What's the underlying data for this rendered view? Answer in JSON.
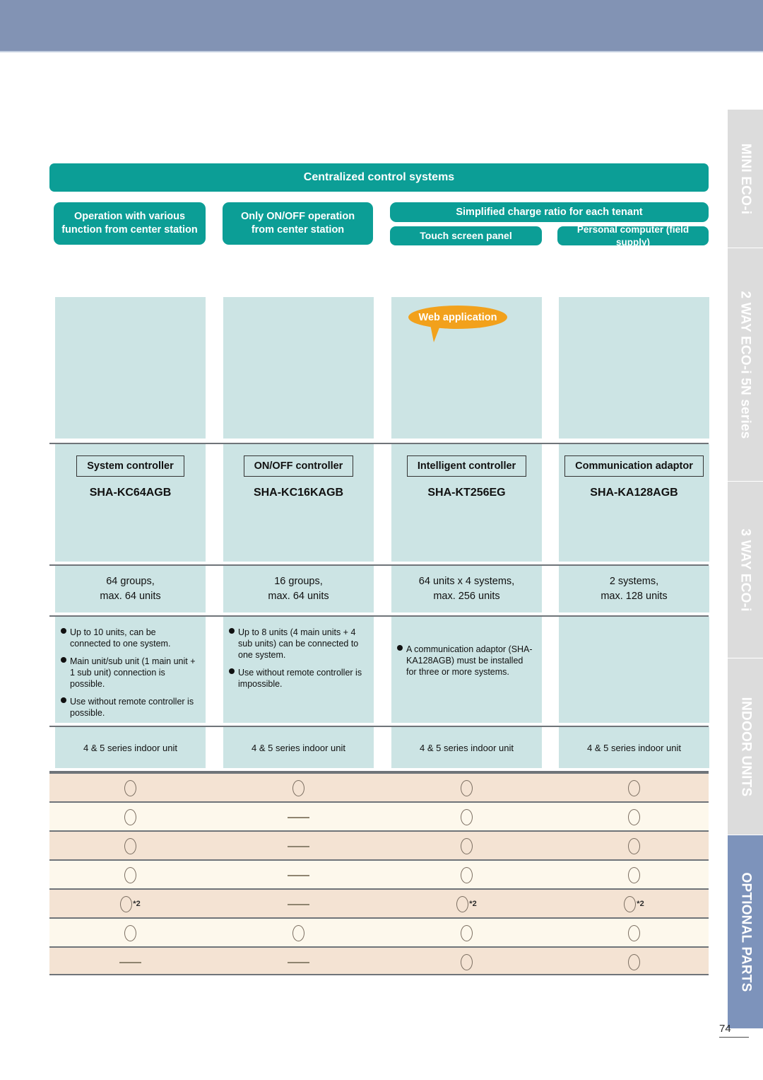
{
  "page": {
    "number": "74"
  },
  "sidebar": {
    "tabs": [
      {
        "label": "MINI ECO-i",
        "active": false
      },
      {
        "label": "2 WAY ECO-i 5N series",
        "active": false
      },
      {
        "label": "3 WAY ECO-i",
        "active": false
      },
      {
        "label": "INDOOR UNITS",
        "active": false
      },
      {
        "label": "OPTIONAL PARTS",
        "active": true
      }
    ],
    "active_color": "#7d93bb",
    "inactive_color": "#dcdcdc"
  },
  "header": {
    "title": "Centralized control systems",
    "categories": [
      "Operation with various function from center station",
      "Only ON/OFF operation from center station"
    ],
    "charge_ratio_title": "Simplified charge ratio for each tenant",
    "charge_ratio_options": [
      "Touch screen panel",
      "Personal computer (field supply)"
    ],
    "accent_color": "#0c9e96"
  },
  "callout": {
    "label": "Web application",
    "color": "#f2a11c"
  },
  "columns": [
    {
      "controller": "System controller",
      "model": "SHA-KC64AGB",
      "capacity_line1": "64 groups,",
      "capacity_line2": "max. 64 units",
      "notes": [
        "Up to 10 units, can be connected to one system.",
        "Main unit/sub unit (1 main unit + 1 sub unit) connection is possible.",
        "Use without remote controller is possible."
      ],
      "indoor_unit": "4 & 5 series indoor unit"
    },
    {
      "controller": "ON/OFF controller",
      "model": "SHA-KC16KAGB",
      "capacity_line1": "16 groups,",
      "capacity_line2": "max. 64 units",
      "notes": [
        "Up to 8 units (4 main units + 4 sub units) can be connected to one system.",
        "Use without remote controller is impossible."
      ],
      "indoor_unit": "4 & 5 series indoor unit"
    },
    {
      "controller": "Intelligent controller",
      "model": "SHA-KT256EG",
      "capacity_line1": "64 units x 4 systems,",
      "capacity_line2": "max. 256 units",
      "notes": [
        "A communication adaptor (SHA-KA128AGB) must be installed for three or more systems."
      ],
      "indoor_unit": "4 & 5 series indoor unit"
    },
    {
      "controller": "Communication adaptor",
      "model": "SHA-KA128AGB",
      "capacity_line1": "2 systems,",
      "capacity_line2": "max. 128 units",
      "notes": [],
      "indoor_unit": "4 & 5 series indoor unit"
    }
  ],
  "symbol_rows": [
    {
      "band": "odd",
      "cells": [
        {
          "sym": "circle"
        },
        {
          "sym": "circle"
        },
        {
          "sym": "circle"
        },
        {
          "sym": "circle"
        }
      ]
    },
    {
      "band": "even",
      "cells": [
        {
          "sym": "circle"
        },
        {
          "sym": "dash"
        },
        {
          "sym": "circle"
        },
        {
          "sym": "circle"
        }
      ]
    },
    {
      "band": "odd",
      "cells": [
        {
          "sym": "circle"
        },
        {
          "sym": "dash"
        },
        {
          "sym": "circle"
        },
        {
          "sym": "circle"
        }
      ]
    },
    {
      "band": "even",
      "cells": [
        {
          "sym": "circle"
        },
        {
          "sym": "dash"
        },
        {
          "sym": "circle"
        },
        {
          "sym": "circle"
        }
      ]
    },
    {
      "band": "odd",
      "cells": [
        {
          "sym": "circle",
          "note": "*2"
        },
        {
          "sym": "dash"
        },
        {
          "sym": "circle",
          "note": "*2"
        },
        {
          "sym": "circle",
          "note": "*2"
        }
      ]
    },
    {
      "band": "even",
      "cells": [
        {
          "sym": "circle"
        },
        {
          "sym": "circle"
        },
        {
          "sym": "circle"
        },
        {
          "sym": "circle"
        }
      ]
    },
    {
      "band": "odd",
      "cells": [
        {
          "sym": "dash"
        },
        {
          "sym": "dash"
        },
        {
          "sym": "circle"
        },
        {
          "sym": "circle"
        }
      ]
    }
  ],
  "palette": {
    "top_band": "#8293b4",
    "image_box": "#cce4e4",
    "band_odd": "#f4e3d3",
    "band_even": "#fdf8ec",
    "rule": "#6f7479"
  }
}
